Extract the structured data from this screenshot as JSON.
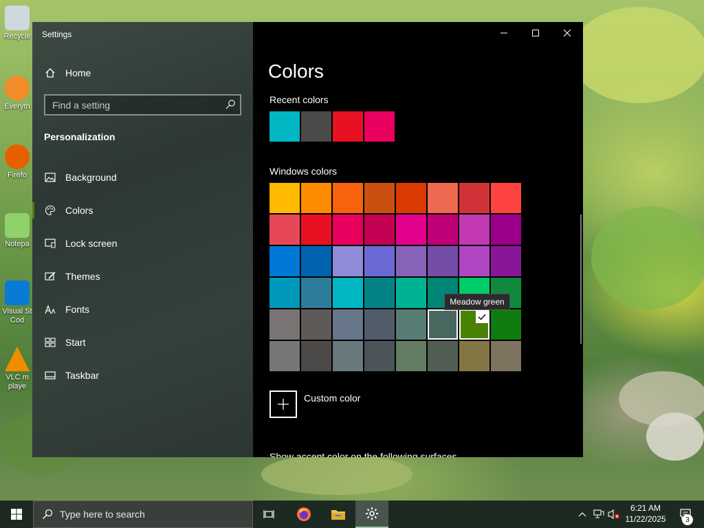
{
  "desktop": {
    "icons": [
      {
        "name": "recycle-bin",
        "label": "Recycle"
      },
      {
        "name": "everything",
        "label": "Everyth"
      },
      {
        "name": "firefox",
        "label": "Firefo"
      },
      {
        "name": "notepad",
        "label": "Notepa"
      },
      {
        "name": "visual-studio-code",
        "label_lines": [
          "Visual St",
          "Cod"
        ]
      },
      {
        "name": "vlc",
        "label_lines": [
          "VLC m",
          "playe"
        ]
      }
    ]
  },
  "window": {
    "title": "Settings",
    "controls": {
      "minimize": "minimize-icon",
      "maximize": "maximize-icon",
      "close": "close-icon"
    }
  },
  "sidebar": {
    "home_label": "Home",
    "search_placeholder": "Find a setting",
    "section_title": "Personalization",
    "items": [
      {
        "label": "Background",
        "icon": "image-icon"
      },
      {
        "label": "Colors",
        "icon": "palette-icon",
        "active": true
      },
      {
        "label": "Lock screen",
        "icon": "lock-screen-icon"
      },
      {
        "label": "Themes",
        "icon": "brush-icon"
      },
      {
        "label": "Fonts",
        "icon": "font-icon"
      },
      {
        "label": "Start",
        "icon": "start-grid-icon"
      },
      {
        "label": "Taskbar",
        "icon": "taskbar-icon"
      }
    ]
  },
  "content": {
    "title": "Colors",
    "recent_title": "Recent colors",
    "recent_colors": [
      "#00b7c3",
      "#4c4a48",
      "#e81123",
      "#ea005e"
    ],
    "windows_title": "Windows colors",
    "windows_colors": [
      [
        "#ffb900",
        "#ff8c00",
        "#f7630c",
        "#ca5010",
        "#da3b01",
        "#ef6950",
        "#d13438",
        "#ff4343"
      ],
      [
        "#e74856",
        "#e81123",
        "#ea005e",
        "#c30052",
        "#e3008c",
        "#bf0077",
        "#c239b3",
        "#9a0089"
      ],
      [
        "#0078d7",
        "#0063b1",
        "#8e8cd8",
        "#6b69d6",
        "#8764b8",
        "#744da9",
        "#b146c2",
        "#881798"
      ],
      [
        "#0099bc",
        "#2d7d9a",
        "#00b7c3",
        "#038387",
        "#00b294",
        "#018574",
        "#00cc6a",
        "#10893e"
      ],
      [
        "#7a7574",
        "#5d5a58",
        "#68768a",
        "#515c6b",
        "#567c73",
        "#486860",
        "#498205",
        "#107c10"
      ],
      [
        "#767676",
        "#4c4a48",
        "#69797e",
        "#4a5459",
        "#647c64",
        "#525e54",
        "#847545",
        "#7e735f"
      ]
    ],
    "hover_index": [
      4,
      5
    ],
    "selected_index": [
      4,
      6
    ],
    "tooltip": "Meadow green",
    "custom_color_label": "Custom color",
    "cut_off_text": "Show accent color on the following surfaces"
  },
  "taskbar": {
    "search_placeholder": "Type here to search",
    "time": "6:21 AM",
    "date": "11/22/2025",
    "notification_count": "3"
  }
}
